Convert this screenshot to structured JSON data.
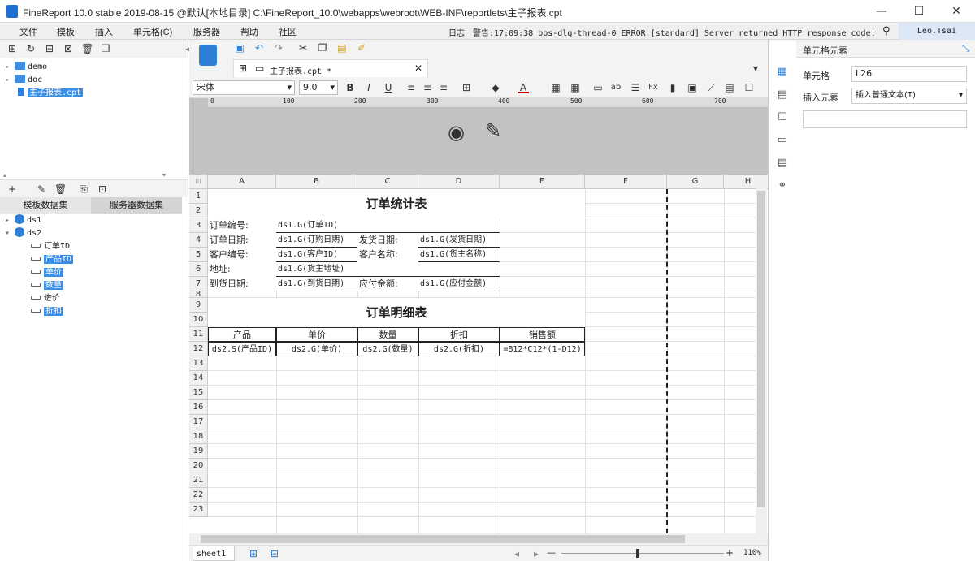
{
  "window": {
    "title": "FineReport 10.0 stable 2019-08-15 @默认[本地目录]   C:\\FineReport_10.0\\webapps\\webroot\\WEB-INF\\reportlets\\主子报表.cpt",
    "min": "—",
    "max": "☐",
    "close": "✕"
  },
  "menu": [
    "文件",
    "模板",
    "插入",
    "单元格(C)",
    "服务器",
    "帮助",
    "社区"
  ],
  "log": {
    "label": "日志",
    "text": "警告:17:09:38 bbs-dlg-thread-0 ERROR [standard] Server returned HTTP response code: 405 fo..."
  },
  "user": "Leo.Tsai",
  "tree": {
    "items": [
      {
        "label": "demo",
        "type": "folder"
      },
      {
        "label": "doc",
        "type": "folder"
      },
      {
        "label": "主子报表.cpt",
        "type": "file"
      }
    ]
  },
  "datasets": {
    "tabs": [
      "模板数据集",
      "服务器数据集"
    ],
    "ds1": "ds1",
    "ds2": "ds2",
    "fields": [
      "订单ID",
      "产品ID",
      "单价",
      "数量",
      "进价",
      "折扣"
    ]
  },
  "editor": {
    "tab": "主子报表.cpt *",
    "font": "宋体",
    "size": "9.0"
  },
  "ruler": [
    "0",
    "100",
    "200",
    "300",
    "400",
    "500",
    "600",
    "700"
  ],
  "columns": [
    "A",
    "B",
    "C",
    "D",
    "E",
    "F",
    "G",
    "H"
  ],
  "rows": [
    "1",
    "2",
    "3",
    "4",
    "5",
    "6",
    "7",
    "8",
    "9",
    "10",
    "11",
    "12",
    "13",
    "14",
    "15",
    "16",
    "17",
    "18",
    "19",
    "20",
    "21",
    "22",
    "23"
  ],
  "report": {
    "title1": "订单统计表",
    "labels": {
      "order_no": "订单编号:",
      "order_date": "订单日期:",
      "ship_date": "发货日期:",
      "cust_no": "客户编号:",
      "cust_name": "客户名称:",
      "address": "地址:",
      "arrive_date": "到货日期:",
      "amount": "应付金额:"
    },
    "values": {
      "order_no": "ds1.G(订单ID)",
      "order_date": "ds1.G(订购日期)",
      "ship_date": "ds1.G(发货日期)",
      "cust_no": "ds1.G(客户ID)",
      "cust_name": "ds1.G(货主名称)",
      "address": "ds1.G(货主地址)",
      "arrive_date": "ds1.G(到货日期)",
      "amount": "ds1.G(应付金额)"
    },
    "title2": "订单明细表",
    "detail_headers": [
      "产品",
      "单价",
      "数量",
      "折扣",
      "销售额"
    ],
    "detail_values": [
      "ds2.S(产品ID)",
      "ds2.G(单价)",
      "ds2.G(数量)",
      "ds2.G(折扣)",
      "=B12*C12*(1-D12)"
    ]
  },
  "right": {
    "title": "单元格元素",
    "cell_label": "单元格",
    "cell_value": "L26",
    "insert_label": "插入元素",
    "insert_value": "插入普通文本(T)"
  },
  "status": {
    "sheet": "sheet1",
    "zoom": "110%",
    "minus": "—",
    "plus": "+"
  }
}
